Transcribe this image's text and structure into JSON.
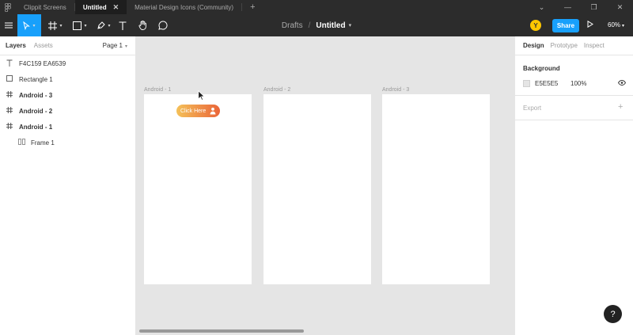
{
  "tabs": [
    {
      "label": "Clippit Screens"
    },
    {
      "label": "Untitled",
      "active": true
    },
    {
      "label": "Material Design Icons (Community)"
    }
  ],
  "toolbar": {
    "breadcrumb_parent": "Drafts",
    "breadcrumb_sep": "/",
    "file_name": "Untitled",
    "avatar_initial": "Y",
    "share_label": "Share",
    "zoom_level": "60%"
  },
  "left_panel": {
    "tabs": [
      "Layers",
      "Assets"
    ],
    "page_selector": "Page 1",
    "layers": [
      {
        "name": "F4C159 EA6539",
        "icon": "text-icon"
      },
      {
        "name": "Rectangle 1",
        "icon": "rectangle-icon"
      },
      {
        "name": "Android - 3",
        "icon": "frame-icon",
        "bold": true
      },
      {
        "name": "Android - 2",
        "icon": "frame-icon",
        "bold": true
      },
      {
        "name": "Android - 1",
        "icon": "frame-icon",
        "bold": true
      },
      {
        "name": "Frame 1",
        "icon": "auto-layout-icon"
      }
    ]
  },
  "canvas": {
    "frames": [
      {
        "label": "Android - 1"
      },
      {
        "label": "Android - 2"
      },
      {
        "label": "Android - 3"
      }
    ],
    "button_label": "Click Here",
    "gradient_colors": [
      "#f4c159",
      "#ea6539"
    ]
  },
  "right_panel": {
    "tabs": [
      "Design",
      "Prototype",
      "Inspect"
    ],
    "background_title": "Background",
    "background_hex": "E5E5E5",
    "background_opacity": "100%",
    "export_title": "Export",
    "export_add": "+"
  },
  "help_label": "?",
  "colors": {
    "accent": "#18a0fb",
    "toolbar_bg": "#2c2c2c",
    "canvas_bg": "#e5e5e5",
    "avatar": "#ffc700"
  }
}
